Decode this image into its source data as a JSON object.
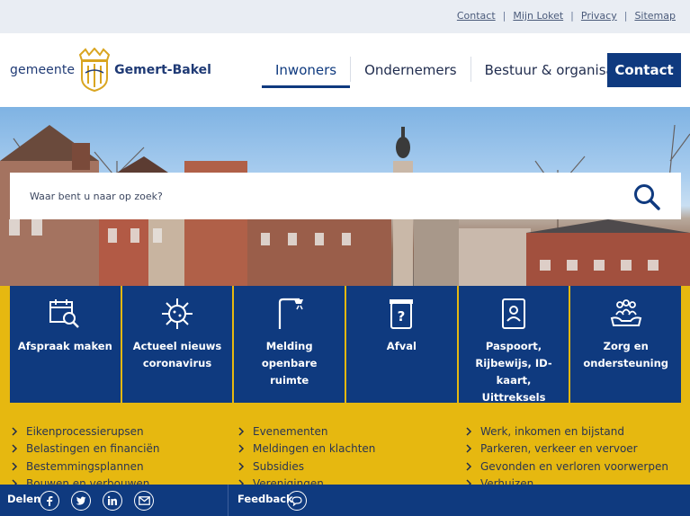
{
  "topbar": {
    "links": [
      {
        "label": "Contact"
      },
      {
        "label": "Mijn Loket"
      },
      {
        "label": "Privacy"
      },
      {
        "label": "Sitemap"
      }
    ],
    "separator": "|"
  },
  "header": {
    "logo_prefix": "gemeente",
    "logo_name": "Gemert-Bakel",
    "nav": [
      {
        "label": "Inwoners",
        "active": true
      },
      {
        "label": "Ondernemers",
        "active": false
      },
      {
        "label": "Bestuur & organisatie",
        "active": false
      }
    ],
    "contact_button": "Contact"
  },
  "search": {
    "placeholder": "Waar bent u naar op zoek?",
    "icon": "search-icon"
  },
  "tiles": [
    {
      "label": "Afspraak maken",
      "icon": "calendar-search-icon"
    },
    {
      "label": "Actueel nieuws coronavirus",
      "icon": "virus-icon"
    },
    {
      "label": "Melding openbare ruimte",
      "icon": "streetlight-icon"
    },
    {
      "label": "Afval",
      "icon": "waste-bin-icon"
    },
    {
      "label": "Paspoort, Rijbewijs, ID-kaart, Uittreksels",
      "icon": "id-card-icon"
    },
    {
      "label": "Zorg en ondersteuning",
      "icon": "care-hands-icon"
    }
  ],
  "links": {
    "col1": [
      "Eikenprocessierupsen",
      "Belastingen en financiën",
      "Bestemmingsplannen",
      "Bouwen en verbouwen"
    ],
    "col2": [
      "Evenementen",
      "Meldingen en klachten",
      "Subsidies",
      "Verenigingen"
    ],
    "col3": [
      "Werk, inkomen en bijstand",
      "Parkeren, verkeer en vervoer",
      "Gevonden en verloren voorwerpen",
      "Verhuizen"
    ]
  },
  "bottombar": {
    "share_label": "Delen",
    "social": [
      "facebook-icon",
      "twitter-icon",
      "linkedin-icon",
      "email-icon"
    ],
    "feedback_label": "Feedback",
    "feedback_icon": "chat-bubble-icon"
  },
  "colors": {
    "primary": "#0f3a7f",
    "accent_yellow": "#e6b810",
    "topbar_bg": "#e9edf3"
  }
}
